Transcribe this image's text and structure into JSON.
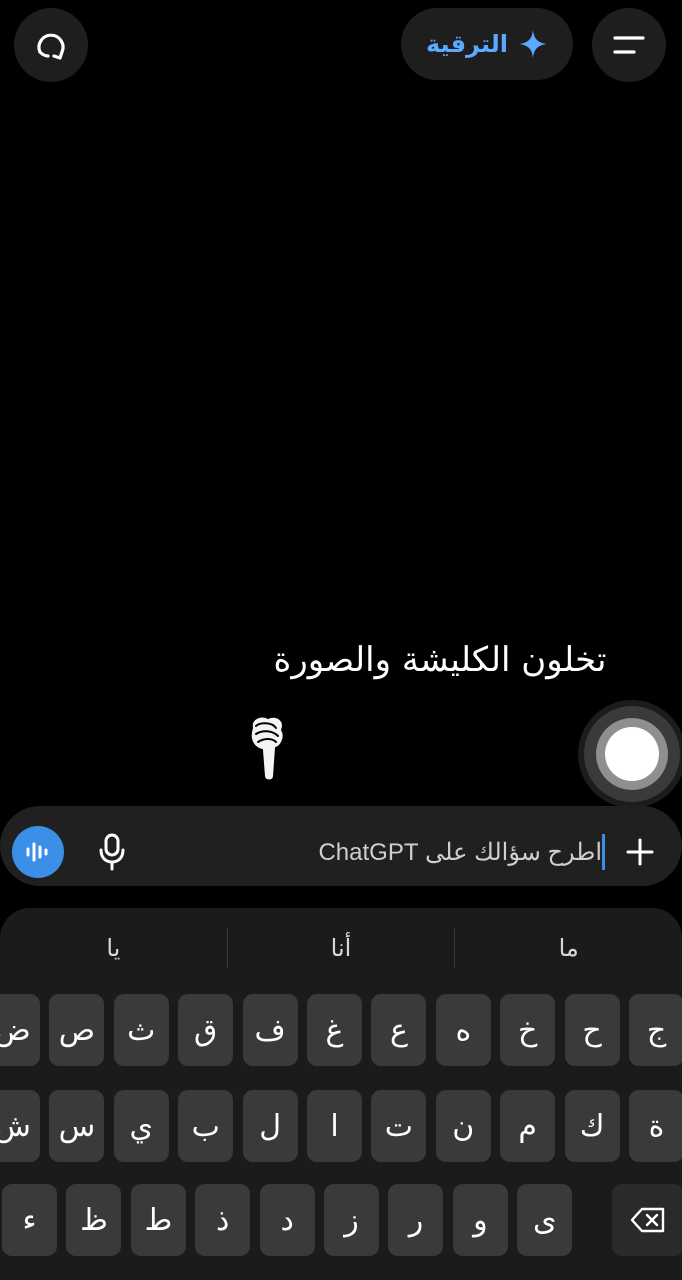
{
  "header": {
    "upgrade_label": "الترقية",
    "accent": "#5aa9ff"
  },
  "overlay": {
    "caption": "تخلون الكليشة والصورة"
  },
  "composer": {
    "placeholder": "اطرح سؤالك على ChatGPT",
    "accent": "#3b8fe6"
  },
  "keyboard": {
    "suggestions": [
      "ما",
      "أنا",
      "يا"
    ],
    "row1": [
      "ج",
      "ح",
      "خ",
      "ه",
      "ع",
      "غ",
      "ف",
      "ق",
      "ث",
      "ص",
      "ض"
    ],
    "row2": [
      "ة",
      "ك",
      "م",
      "ن",
      "ت",
      "ا",
      "ل",
      "ب",
      "ي",
      "س",
      "ش"
    ],
    "row3": [
      "ى",
      "و",
      "ر",
      "ز",
      "د",
      "ذ",
      "ط",
      "ظ",
      "ء"
    ],
    "icons": {
      "backspace": "backspace-icon"
    }
  }
}
